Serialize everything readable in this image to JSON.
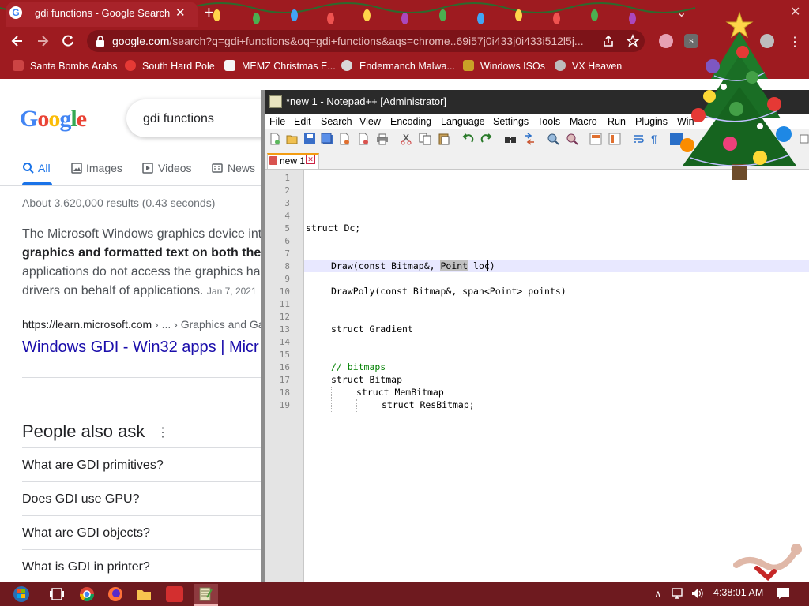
{
  "browser": {
    "tab_title": "gdi functions - Google Search",
    "tab_close": "✕",
    "new_tab": "+",
    "url_host": "google.com",
    "url_rest": "/search?q=gdi+functions&oq=gdi+functions&aqs=chrome..69i57j0i433j0i433i512l5j...",
    "bookmarks": [
      "Santa Bombs Arabs",
      "South Hard Pole",
      "MEMZ Christmas E...",
      "Endermanch Malwa...",
      "Windows ISOs",
      "VX Heaven"
    ]
  },
  "google": {
    "logo": "Google",
    "query": "gdi functions",
    "tabs": [
      "All",
      "Images",
      "Videos",
      "News"
    ],
    "results_count": "About 3,620,000 results (0.43 seconds)",
    "snippet_lines": [
      "The Microsoft Windows graphics device int",
      "graphics and formatted text on both the",
      "applications do not access the graphics ha",
      "drivers on behalf of applications."
    ],
    "snippet_date": "Jan 7, 2021",
    "cite_host": "https://learn.microsoft.com",
    "cite_path": " › ... › Graphics and Ga",
    "result_title": "Windows GDI - Win32 apps | Micr",
    "paa_title": "People also ask",
    "paa_questions": [
      "What are GDI primitives?",
      "Does GDI use GPU?",
      "What are GDI objects?",
      "What is GDI in printer?"
    ]
  },
  "notepad": {
    "title": "*new 1 - Notepad++ [Administrator]",
    "menu": [
      "File",
      "Edit",
      "Search",
      "View",
      "Encoding",
      "Language",
      "Settings",
      "Tools",
      "Macro",
      "Run",
      "Plugins",
      "Win"
    ],
    "doc_tab": "new 1",
    "line_numbers": [
      "1",
      "2",
      "3",
      "4",
      "5",
      "6",
      "7",
      "8",
      "9",
      "10",
      "11",
      "12",
      "13",
      "14",
      "15",
      "16",
      "17",
      "18",
      "19"
    ],
    "code": {
      "l5": "struct Dc;",
      "l8_pre": "Draw(const Bitmap&, ",
      "l8_sel": "Point",
      "l8_post": " loc)",
      "l10": "DrawPoly(const Bitmap&, span<Point> points)",
      "l13": "struct Gradient",
      "l16": "// bitmaps",
      "l17": "struct Bitmap",
      "l18": "struct MemBitmap",
      "l19": "struct ResBitmap;"
    }
  },
  "taskbar": {
    "clock": "4:38:01 AM"
  }
}
